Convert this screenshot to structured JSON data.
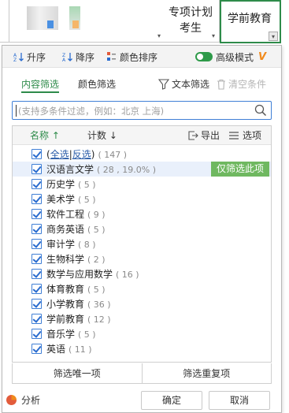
{
  "sheet": {
    "col1_header": "专项计划考生",
    "col2_header": "学前教育"
  },
  "toolbar": {
    "sort_asc": "升序",
    "sort_desc": "降序",
    "color_sort": "颜色排序",
    "advanced_mode": "高级模式",
    "vip_badge": "V"
  },
  "tabs": {
    "content_filter": "内容筛选",
    "color_filter": "颜色筛选",
    "text_filter": "文本筛选",
    "clear_conditions": "清空条件"
  },
  "search": {
    "placeholder": "(支持多条件过滤，例如：北京 上海)"
  },
  "list_header": {
    "name": "名称",
    "count": "计数",
    "export": "导出",
    "options": "选项"
  },
  "list": {
    "select_all": "全选",
    "invert": "反选",
    "total_count": "( 147 )",
    "only_filter_label": "仅筛选此项",
    "items": [
      {
        "label": "汉语言文学",
        "count": "( 28 , 19.0% )"
      },
      {
        "label": "历史学",
        "count": "( 5 )"
      },
      {
        "label": "美术学",
        "count": "( 5 )"
      },
      {
        "label": "软件工程",
        "count": "( 9 )"
      },
      {
        "label": "商务英语",
        "count": "( 5 )"
      },
      {
        "label": "审计学",
        "count": "( 8 )"
      },
      {
        "label": "生物科学",
        "count": "( 2 )"
      },
      {
        "label": "数学与应用数学",
        "count": "( 16 )"
      },
      {
        "label": "体育教育",
        "count": "( 5 )"
      },
      {
        "label": "小学教育",
        "count": "( 36 )"
      },
      {
        "label": "学前教育",
        "count": "( 12 )"
      },
      {
        "label": "音乐学",
        "count": "( 5 )"
      },
      {
        "label": "英语",
        "count": "( 11 )"
      }
    ]
  },
  "bottom": {
    "unique": "筛选唯一项",
    "duplicate": "筛选重复项"
  },
  "footer": {
    "analyze": "分析",
    "ok": "确定",
    "cancel": "取消"
  },
  "colors": {
    "accent_green": "#2e8b4a",
    "focus_blue": "#3f7fd6",
    "highlight_green": "#6fb860",
    "vip_orange": "#f08a1c"
  }
}
